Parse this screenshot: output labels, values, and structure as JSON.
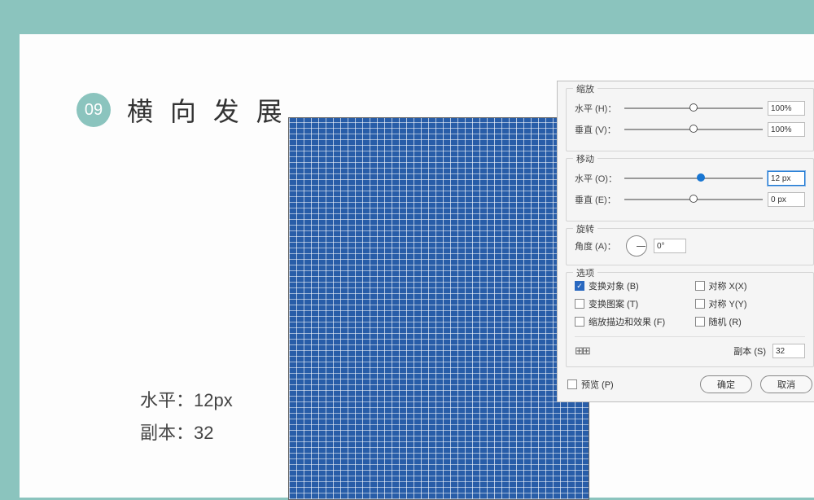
{
  "badge": "09",
  "title": "横 向 发 展",
  "caption": {
    "line1": "水平：12px",
    "line2": "副本：32"
  },
  "dialog": {
    "scale": {
      "title": "缩放",
      "h_label": "水平 (H)：",
      "h_val": "100%",
      "v_label": "垂直 (V)：",
      "v_val": "100%"
    },
    "move": {
      "title": "移动",
      "h_label": "水平 (O)：",
      "h_val": "12 px",
      "v_label": "垂直 (E)：",
      "v_val": "0 px"
    },
    "rotate": {
      "title": "旋转",
      "label": "角度 (A)：",
      "val": "0°"
    },
    "options": {
      "title": "选项",
      "transform_obj": "变换对象 (B)",
      "mirror_x": "对称 X(X)",
      "transform_pattern": "变换图案 (T)",
      "mirror_y": "对称 Y(Y)",
      "scale_stroke": "缩放描边和效果 (F)",
      "random": "随机 (R)",
      "copies_label": "副本 (S)",
      "copies_val": "32"
    },
    "footer": {
      "preview": "预览 (P)",
      "ok": "确定",
      "cancel": "取消"
    }
  }
}
